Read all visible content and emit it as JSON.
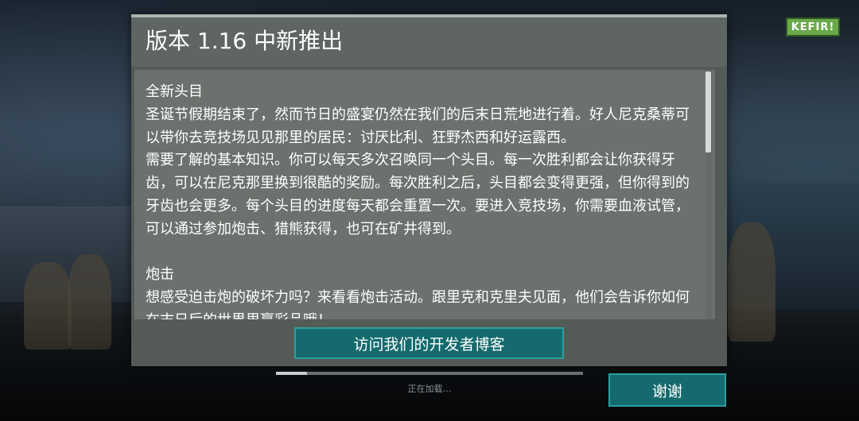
{
  "brand": {
    "logo_text": "KEFIR!"
  },
  "dialog": {
    "title": "版本 1.16 中新推出",
    "content": "全新头目\n圣诞节假期结束了，然而节日的盛宴仍然在我们的后末日荒地进行着。好人尼克桑蒂可以带你去竞技场见见那里的居民：讨厌比利、狂野杰西和好运露西。\n需要了解的基本知识。你可以每天多次召唤同一个头目。每一次胜利都会让你获得牙齿，可以在尼克那里换到很酷的奖励。每次胜利之后，头目都会变得更强，但你得到的牙齿也会更多。每个头目的进度每天都会重置一次。要进入竞技场，你需要血液试管，可以通过参加炮击、猎熊获得，也可在矿井得到。\n\n炮击\n想感受迫击炮的破坏力吗？来看看炮击活动。跟里克和克里夫见面，他们会告诉你如何在末日后的世界里赢彩品哦！",
    "blog_button_label": "访问我们的开发者博客"
  },
  "loading": {
    "text": "正在加载…",
    "progress": 0.1
  },
  "thanks_button_label": "谢谢"
}
